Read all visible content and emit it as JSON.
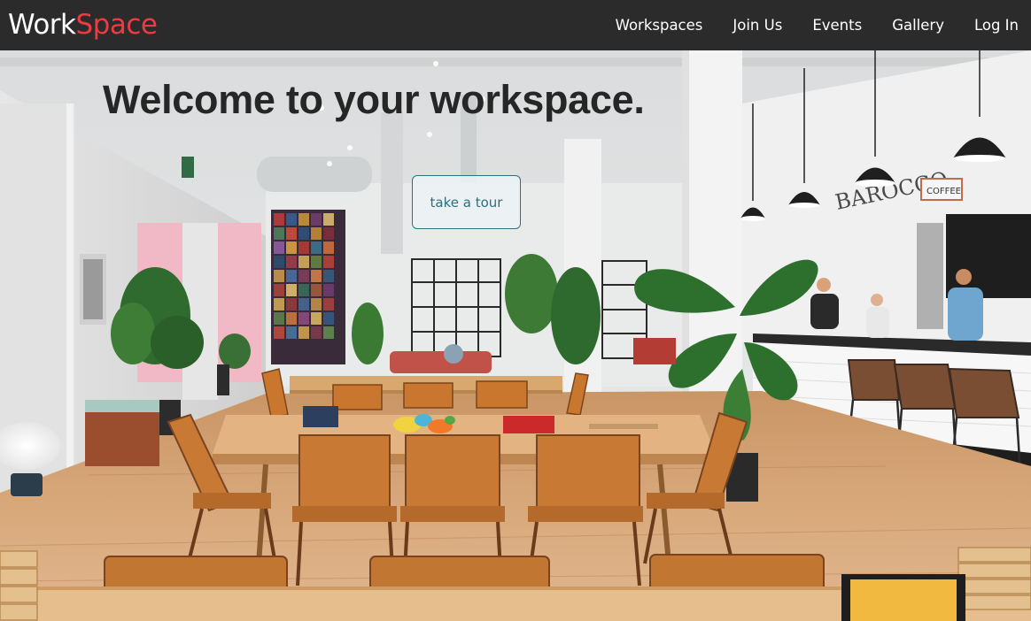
{
  "brand": {
    "part1": "Work",
    "part2": "Space"
  },
  "nav": {
    "links": [
      "Workspaces",
      "Join Us",
      "Events",
      "Gallery",
      "Log In"
    ]
  },
  "hero": {
    "title": "Welcome to your workspace.",
    "cta_label": "take a tour",
    "image_description": "",
    "signage": {
      "cafe_name": "BAROCCO",
      "cafe_label": "COFFEE"
    }
  },
  "colors": {
    "navbar_bg": "#2b2b2b",
    "brand_accent": "#ee3a43",
    "title_color": "#262626",
    "cta_color": "#2e6f80"
  }
}
